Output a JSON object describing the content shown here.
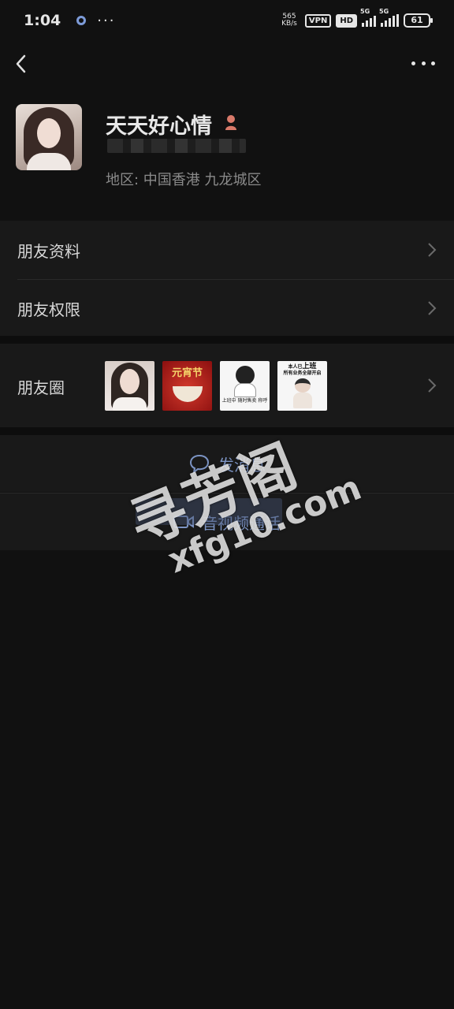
{
  "status_bar": {
    "time": "1:04",
    "more": "···",
    "net_speed_value": "565",
    "net_speed_unit": "KB/s",
    "vpn": "VPN",
    "hd": "HD",
    "network_1": "5G",
    "network_2": "5G",
    "battery": "61"
  },
  "profile": {
    "nickname": "天天好心情",
    "region": "地区:  中国香港  九龙城区"
  },
  "menu": {
    "friend_info": "朋友资料",
    "friend_permissions": "朋友权限"
  },
  "moments": {
    "label": "朋友圈",
    "thumb_2_title": "元宵节",
    "thumb_3_text": "上班中 随时售卖 称呼",
    "thumb_4_line1": "本人已",
    "thumb_4_line1_bold": "上班",
    "thumb_4_line2": "所有业务全部开启"
  },
  "actions": {
    "send_message": "发消息",
    "video_call": "音视频通话"
  },
  "watermark": {
    "chinese": "寻芳阁",
    "domain": "xfg10.com"
  },
  "colors": {
    "background": "#111111",
    "card": "#191919",
    "link_blue": "#7c94c4",
    "muted_text": "#8a8a8a"
  }
}
